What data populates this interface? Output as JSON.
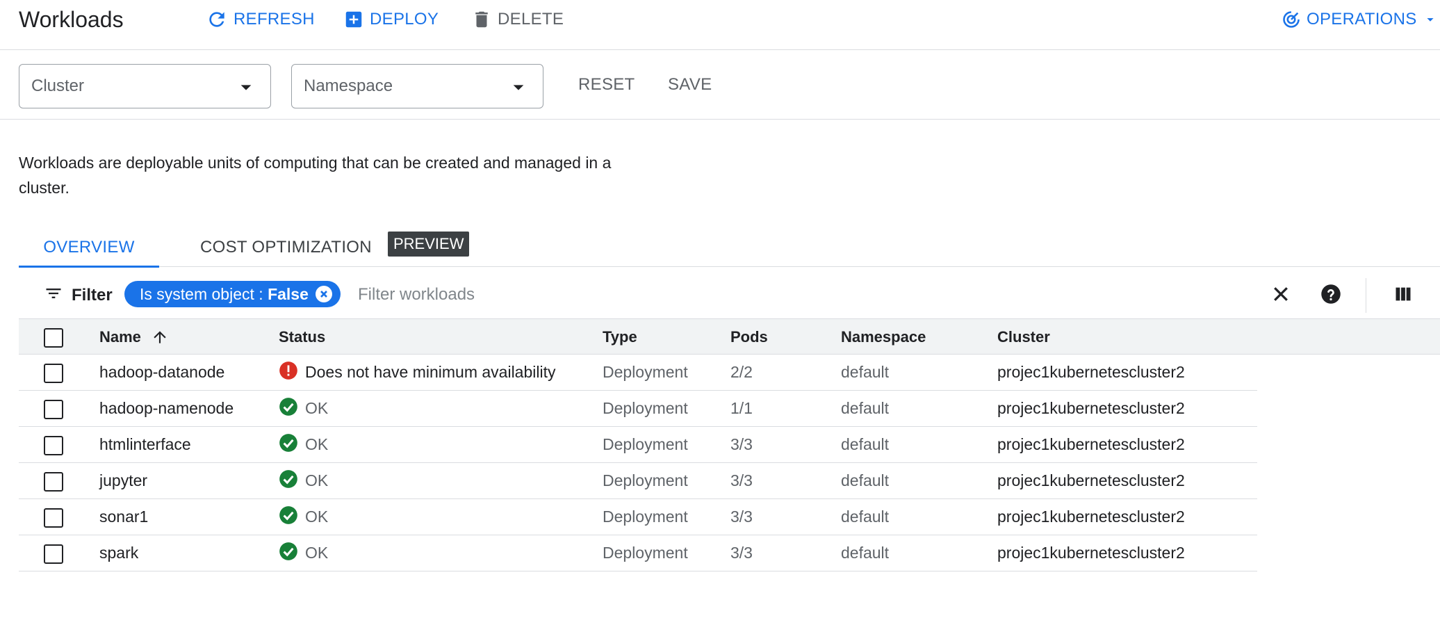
{
  "header": {
    "title": "Workloads",
    "refresh_label": "REFRESH",
    "deploy_label": "DEPLOY",
    "delete_label": "DELETE",
    "operations_label": "OPERATIONS"
  },
  "filters": {
    "cluster_placeholder": "Cluster",
    "namespace_placeholder": "Namespace",
    "reset_label": "RESET",
    "save_label": "SAVE"
  },
  "description": "Workloads are deployable units of computing that can be created and managed in a cluster.",
  "tabs": [
    {
      "label": "OVERVIEW",
      "active": true
    },
    {
      "label": "COST OPTIMIZATION",
      "active": false,
      "badge": "PREVIEW"
    }
  ],
  "table_filter": {
    "filter_label": "Filter",
    "chip_key": "Is system object : ",
    "chip_value": "False",
    "search_placeholder": "Filter workloads"
  },
  "table": {
    "columns": [
      "Name",
      "Status",
      "Type",
      "Pods",
      "Namespace",
      "Cluster"
    ],
    "rows": [
      {
        "name": "hadoop-datanode",
        "status": "Does not have minimum availability",
        "status_kind": "error",
        "type": "Deployment",
        "pods": "2/2",
        "namespace": "default",
        "cluster": "projec1kubernetescluster2"
      },
      {
        "name": "hadoop-namenode",
        "status": "OK",
        "status_kind": "ok",
        "type": "Deployment",
        "pods": "1/1",
        "namespace": "default",
        "cluster": "projec1kubernetescluster2"
      },
      {
        "name": "htmlinterface",
        "status": "OK",
        "status_kind": "ok",
        "type": "Deployment",
        "pods": "3/3",
        "namespace": "default",
        "cluster": "projec1kubernetescluster2"
      },
      {
        "name": "jupyter",
        "status": "OK",
        "status_kind": "ok",
        "type": "Deployment",
        "pods": "3/3",
        "namespace": "default",
        "cluster": "projec1kubernetescluster2"
      },
      {
        "name": "sonar1",
        "status": "OK",
        "status_kind": "ok",
        "type": "Deployment",
        "pods": "3/3",
        "namespace": "default",
        "cluster": "projec1kubernetescluster2"
      },
      {
        "name": "spark",
        "status": "OK",
        "status_kind": "ok",
        "type": "Deployment",
        "pods": "3/3",
        "namespace": "default",
        "cluster": "projec1kubernetescluster2"
      }
    ]
  },
  "colors": {
    "accent": "#1a73e8",
    "ok": "#188038",
    "error": "#d93025"
  },
  "icons": {
    "refresh": "refresh-icon",
    "deploy": "add-box-icon",
    "delete": "trash-icon",
    "operations": "operations-icon",
    "filter": "filter-icon",
    "close": "close-icon",
    "help": "help-icon",
    "columns": "column-display-icon",
    "sort": "sort-arrow-up-icon",
    "ok": "check-circle-icon",
    "error": "error-icon"
  }
}
